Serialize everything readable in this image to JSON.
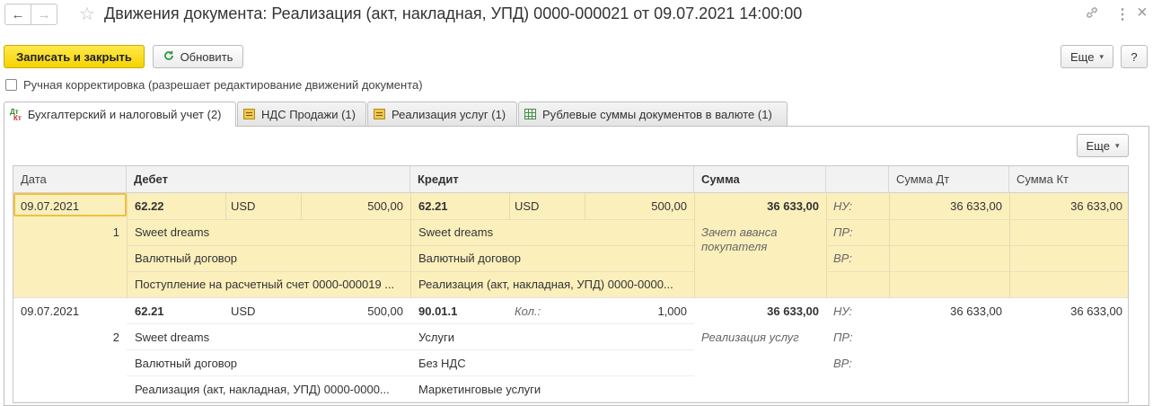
{
  "window": {
    "title": "Движения документа: Реализация (акт, накладная, УПД) 0000-000021 от 09.07.2021 14:00:00",
    "back_icon": "←",
    "forward_icon": "→",
    "star_icon": "☆",
    "link_icon": "🔗",
    "menu_icon": "⋮",
    "close_icon": "×"
  },
  "toolbar": {
    "save_close_label": "Записать и закрыть",
    "refresh_label": "Обновить",
    "refresh_icon": "C",
    "more_label": "Еще",
    "help_label": "?"
  },
  "manual_edit": {
    "label": "Ручная корректировка (разрешает редактирование движений документа)",
    "checked": false
  },
  "tabs": [
    {
      "label": "Бухгалтерский и налоговый учет (2)",
      "icon": "dt-kt-icon",
      "active": true
    },
    {
      "label": "НДС Продажи (1)",
      "icon": "register-icon",
      "active": false
    },
    {
      "label": "Реализация услуг (1)",
      "icon": "register-icon",
      "active": false
    },
    {
      "label": "Рублевые суммы документов в валюте (1)",
      "icon": "grid-icon",
      "active": false
    }
  ],
  "table_toolbar": {
    "more_label": "Еще"
  },
  "columns": {
    "date": "Дата",
    "debit": "Дебет",
    "credit": "Кредит",
    "sum": "Сумма",
    "blank": "",
    "sum_dt": "Сумма Дт",
    "sum_kt": "Сумма Кт"
  },
  "rows": [
    {
      "date": "09.07.2021",
      "num": "1",
      "debit_account": "62.22",
      "debit_currency": "USD",
      "debit_amount": "500,00",
      "debit_sub1": "Sweet dreams",
      "debit_sub2": "Валютный договор",
      "debit_sub3": "Поступление на расчетный счет 0000-000019 ...",
      "credit_account": "62.21",
      "credit_currency": "USD",
      "credit_amount": "500,00",
      "credit_sub1": "Sweet dreams",
      "credit_sub2": "Валютный договор",
      "credit_sub3": "Реализация (акт, накладная, УПД) 0000-0000...",
      "sum": "36 633,00",
      "content": "Зачет аванса покупателя",
      "nu": "НУ:",
      "pr": "ПР:",
      "vr": "ВР:",
      "sum_dt": "36 633,00",
      "sum_kt": "36 633,00"
    },
    {
      "date": "09.07.2021",
      "num": "2",
      "debit_account": "62.21",
      "debit_currency": "USD",
      "debit_amount": "500,00",
      "debit_sub1": "Sweet dreams",
      "debit_sub2": "Валютный договор",
      "debit_sub3": "Реализация (акт, накладная, УПД) 0000-0000...",
      "credit_account": "90.01.1",
      "credit_qty_label": "Кол.:",
      "credit_qty": "1,000",
      "credit_sub1": "Услуги",
      "credit_sub2": "Без НДС",
      "credit_sub3": "Маркетинговые услуги",
      "sum": "36 633,00",
      "content": "Реализация услуг",
      "nu": "НУ:",
      "pr": "ПР:",
      "vr": "ВР:",
      "sum_dt": "36 633,00",
      "sum_kt": "36 633,00"
    }
  ]
}
